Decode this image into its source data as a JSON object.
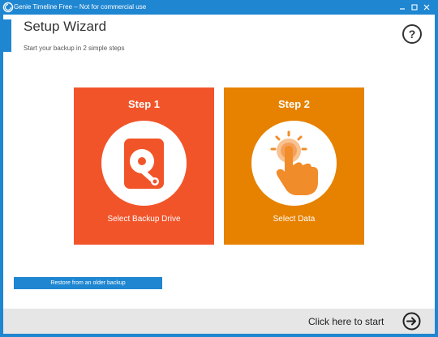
{
  "window": {
    "title": "Genie Timeline Free – Not for commercial use",
    "accent_color": "#1f86d2"
  },
  "header": {
    "title": "Setup Wizard",
    "subtitle": "Start your backup in 2 simple steps",
    "help_label": "?"
  },
  "steps": [
    {
      "label": "Step 1",
      "caption": "Select Backup Drive",
      "color": "#f2542a",
      "icon": "hard-drive-icon"
    },
    {
      "label": "Step 2",
      "caption": "Select Data",
      "color": "#e68200",
      "icon": "touch-hand-icon"
    }
  ],
  "restore": {
    "label": "Restore from an older backup"
  },
  "footer": {
    "start_label": "Click here to start",
    "icon": "arrow-right-circle-icon"
  }
}
